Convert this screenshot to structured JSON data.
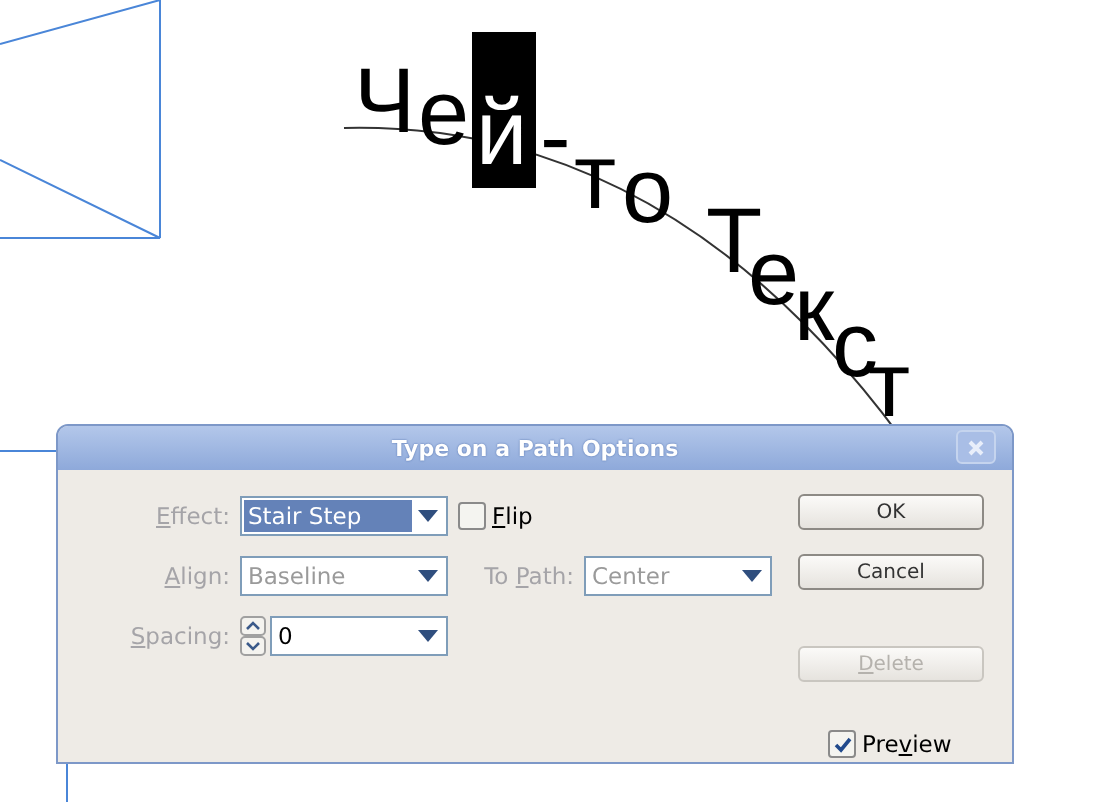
{
  "canvas": {
    "path_text": {
      "before": "Че",
      "selected": "й",
      "after": "-то Текст"
    }
  },
  "dialog": {
    "title": "Type on a Path Options",
    "effect": {
      "label": {
        "key": "E",
        "after": "ffect:"
      },
      "value": "Stair Step",
      "highlighted": true
    },
    "flip": {
      "label": {
        "key": "F",
        "after": "lip"
      },
      "checked": false
    },
    "align": {
      "label": {
        "key": "A",
        "after": "lign:"
      },
      "value": "Baseline",
      "highlighted": false,
      "disabled": true
    },
    "to_path": {
      "label": {
        "before": "To ",
        "key": "P",
        "after": "ath:"
      },
      "value": "Center",
      "highlighted": false,
      "disabled": true
    },
    "spacing": {
      "label": {
        "key": "S",
        "after": "pacing:"
      },
      "value": "0"
    },
    "buttons": [
      {
        "label": {
          "before": "OK"
        },
        "disabled": false
      },
      {
        "label": {
          "before": "Cancel"
        },
        "disabled": false
      },
      {
        "label": {
          "key": "D",
          "after": "elete"
        },
        "disabled": true
      }
    ],
    "preview": {
      "label": {
        "before": "Pre",
        "key": "v",
        "after": "iew"
      },
      "checked": true
    }
  }
}
